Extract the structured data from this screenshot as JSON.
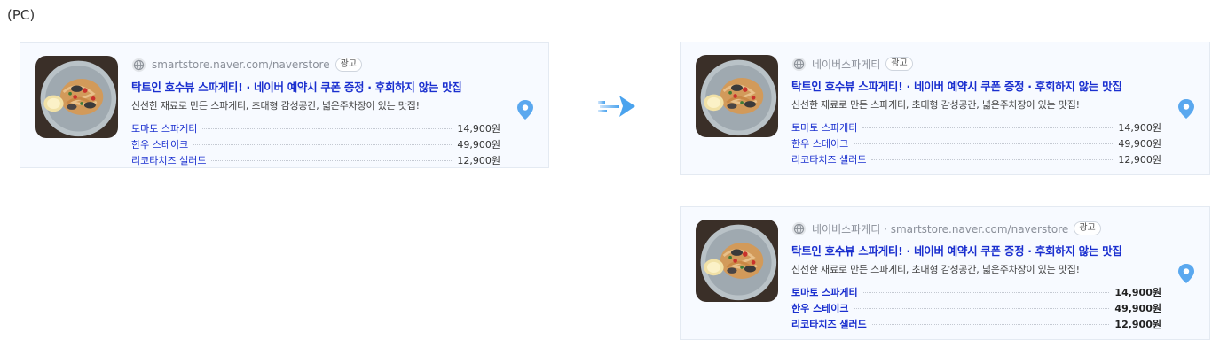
{
  "page_label": "(PC)",
  "badge_label": "광고",
  "title": "탁트인 호수뷰 스파게티! · 네이버 예약시 쿠폰 증정 · 후회하지 않는 맛집",
  "description": "신선한 재료로 만든 스파게티, 초대형 감성공간, 넓은주차장이 있는 맛집!",
  "menu": [
    {
      "name": "토마토 스파게티",
      "price": "14,900원"
    },
    {
      "name": "한우 스테이크",
      "price": "49,900원"
    },
    {
      "name": "리코타치즈 샐러드",
      "price": "12,900원"
    }
  ],
  "cards": {
    "before": {
      "source": "smartstore.naver.com/naverstore"
    },
    "after_a": {
      "source": "네이버스파게티"
    },
    "after_b": {
      "source": "네이버스파게티 · smartstore.naver.com/naverstore"
    }
  },
  "icons": [
    "globe-icon",
    "map-pin-icon",
    "arrow-right-icon"
  ],
  "colors": {
    "title_blue": "#1a2fcf",
    "card_bg": "#f7faff",
    "pin_blue": "#5aa8ef",
    "arrow_blue": "#4aa3ee"
  }
}
